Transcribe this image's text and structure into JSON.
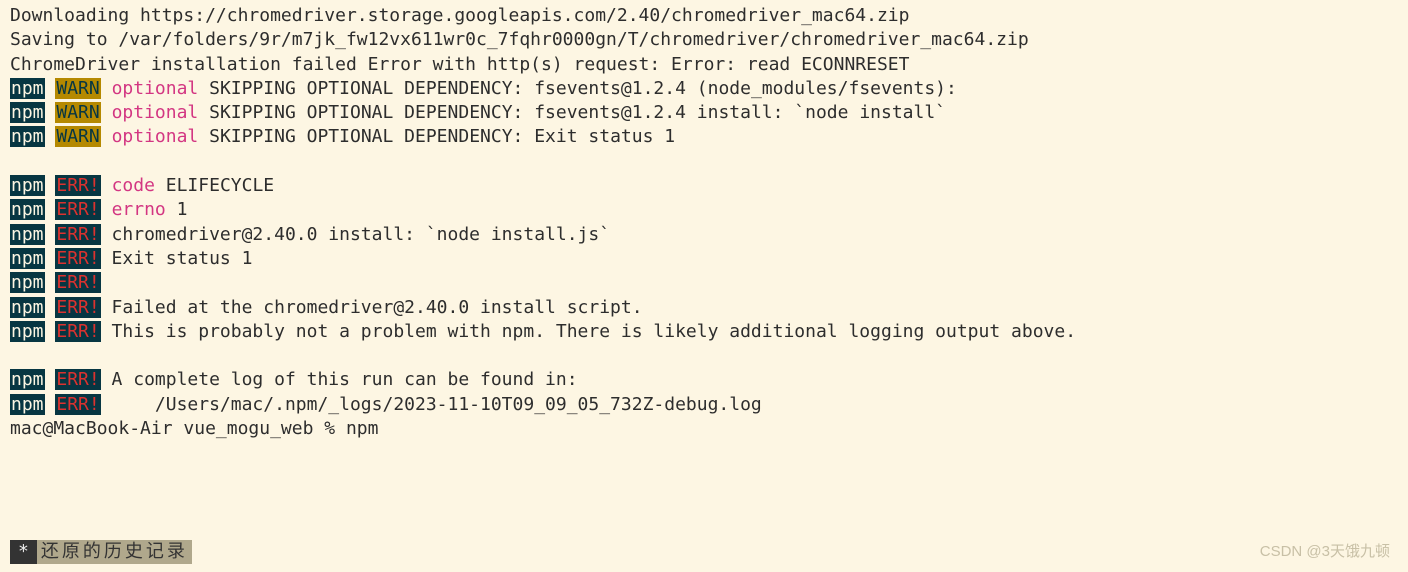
{
  "lines": {
    "download": "Downloading https://chromedriver.storage.googleapis.com/2.40/chromedriver_mac64.zip",
    "saving": "Saving to /var/folders/9r/m7jk_fw12vx611wr0c_7fqhr0000gn/T/chromedriver/chromedriver_mac64.zip",
    "install_fail": "ChromeDriver installation failed Error with http(s) request: Error: read ECONNRESET"
  },
  "npm_label": "npm",
  "warn_label": "WARN",
  "err_label": "ERR!",
  "optional_label": "optional",
  "warn_lines": [
    " SKIPPING OPTIONAL DEPENDENCY: fsevents@1.2.4 (node_modules/fsevents):",
    " SKIPPING OPTIONAL DEPENDENCY: fsevents@1.2.4 install: `node install`",
    " SKIPPING OPTIONAL DEPENDENCY: Exit status 1"
  ],
  "err_lines": [
    {
      "key": "code",
      "rest": " ELIFECYCLE"
    },
    {
      "key": "errno",
      "rest": " 1"
    },
    {
      "key": "",
      "rest": " chromedriver@2.40.0 install: `node install.js`"
    },
    {
      "key": "",
      "rest": " Exit status 1"
    },
    {
      "key": "",
      "rest": ""
    },
    {
      "key": "",
      "rest": " Failed at the chromedriver@2.40.0 install script."
    },
    {
      "key": "",
      "rest": " This is probably not a problem with npm. There is likely additional logging output above."
    }
  ],
  "err_lines2": [
    {
      "rest": " A complete log of this run can be found in:"
    },
    {
      "rest": "     /Users/mac/.npm/_logs/2023-11-10T09_09_05_732Z-debug.log"
    }
  ],
  "prompt": "mac@MacBook-Air vue_mogu_web % npm",
  "statusbar": {
    "star": "*",
    "text": " 还原的历史记录 "
  },
  "watermark": "CSDN @3天饿九顿"
}
